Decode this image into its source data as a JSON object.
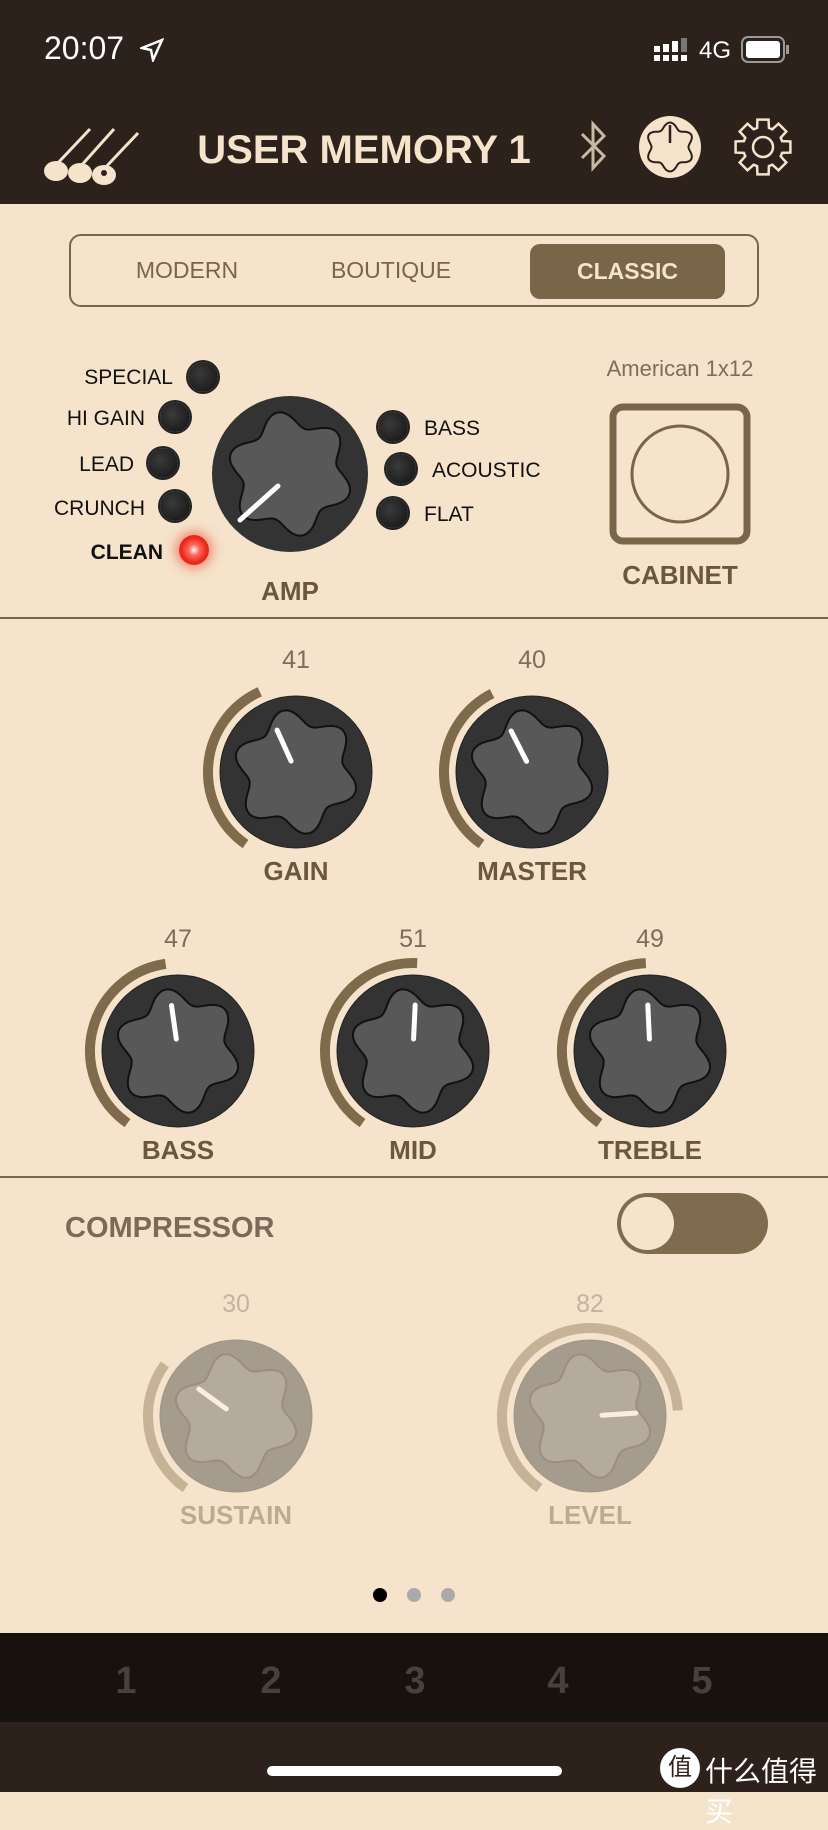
{
  "status": {
    "time": "20:07",
    "network": "4G"
  },
  "header": {
    "title": "USER MEMORY 1",
    "icons": [
      "guitars-icon",
      "bluetooth-icon",
      "knob-icon",
      "gear-icon"
    ]
  },
  "segments": {
    "items": [
      "MODERN",
      "BOUTIQUE",
      "CLASSIC"
    ],
    "selected": "CLASSIC"
  },
  "amp": {
    "label": "AMP",
    "left_types": [
      "SPECIAL",
      "HI GAIN",
      "LEAD",
      "CRUNCH",
      "CLEAN"
    ],
    "right_types": [
      "BASS",
      "ACOUSTIC",
      "FLAT"
    ],
    "selected": "CLEAN"
  },
  "cabinet": {
    "label": "CABINET",
    "type": "American 1x12"
  },
  "knobs": [
    {
      "id": "gain",
      "label": "GAIN",
      "value": "41"
    },
    {
      "id": "master",
      "label": "MASTER",
      "value": "40"
    },
    {
      "id": "bass",
      "label": "BASS",
      "value": "47"
    },
    {
      "id": "mid",
      "label": "MID",
      "value": "51"
    },
    {
      "id": "treble",
      "label": "TREBLE",
      "value": "49"
    }
  ],
  "compressor": {
    "label": "COMPRESSOR",
    "enabled": false,
    "knobs": [
      {
        "id": "sustain",
        "label": "SUSTAIN",
        "value": "30"
      },
      {
        "id": "level",
        "label": "LEVEL",
        "value": "82"
      }
    ]
  },
  "pager": {
    "count": 3,
    "current": 1
  },
  "memories": [
    "1",
    "2",
    "3",
    "4",
    "5"
  ],
  "watermark": "什么值得买",
  "colors": {
    "background": "#f5e3cb",
    "header": "#2d221b",
    "accent": "#7a6549",
    "led_on": "#e8281c"
  }
}
